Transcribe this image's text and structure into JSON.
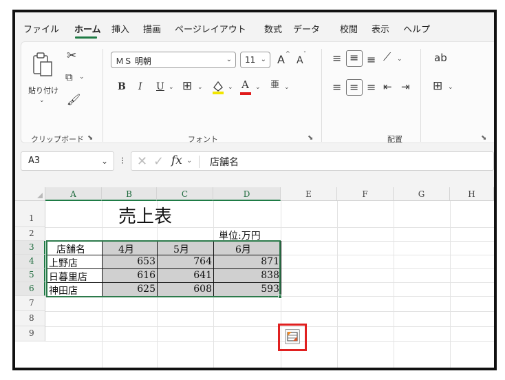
{
  "menu_tabs": [
    {
      "label": "ファイル"
    },
    {
      "label": "ホーム"
    },
    {
      "label": "挿入"
    },
    {
      "label": "描画"
    },
    {
      "label": "ページレイアウト"
    },
    {
      "label": "数式"
    },
    {
      "label": "データ"
    },
    {
      "label": "校閲"
    },
    {
      "label": "表示"
    },
    {
      "label": "ヘルプ"
    }
  ],
  "active_tab": "ホーム",
  "ribbon": {
    "clipboard": {
      "paste_label": "貼り付け",
      "group_label": "クリップボード"
    },
    "font": {
      "font_name": "ＭＳ 明朝",
      "font_size": "11",
      "grow_font": "A",
      "shrink_font": "A",
      "bold": "B",
      "italic": "I",
      "underline": "U",
      "font_color_glyph": "A",
      "group_label": "フォント"
    },
    "alignment": {
      "group_label": "配置"
    }
  },
  "formula_bar": {
    "name_box": "A3",
    "fx": "fx",
    "content": "店舗名"
  },
  "columns": [
    "A",
    "B",
    "C",
    "D",
    "E",
    "F",
    "G",
    "H"
  ],
  "rows": [
    "1",
    "2",
    "3",
    "4",
    "5",
    "6",
    "7",
    "8",
    "9"
  ],
  "sheet": {
    "title": "売上表",
    "unit": "単位:万円",
    "headers": [
      "店舗名",
      "4月",
      "5月",
      "6月"
    ],
    "data_rows": [
      {
        "store": "上野店",
        "values": [
          "653",
          "764",
          "871"
        ]
      },
      {
        "store": "日暮里店",
        "values": [
          "616",
          "641",
          "838"
        ]
      },
      {
        "store": "神田店",
        "values": [
          "625",
          "608",
          "593"
        ]
      }
    ]
  },
  "colors": {
    "accent_green": "#1e7b45",
    "highlight_red": "#e02020",
    "table_shading": "#d0d0d0"
  },
  "icons": {
    "cut": "scissors-icon",
    "copy": "copy-icon",
    "format_painter": "brush-icon",
    "quick_analysis": "quick-analysis-icon"
  }
}
